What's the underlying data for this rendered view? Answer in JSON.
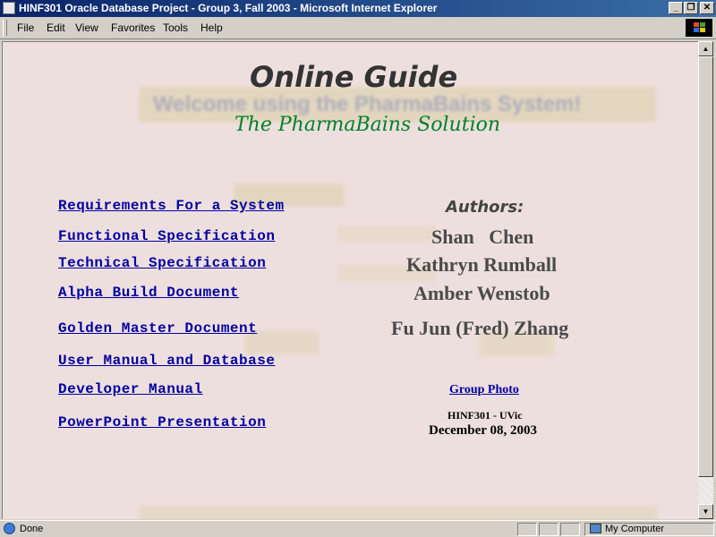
{
  "window": {
    "title": "HINF301 Oracle Database Project - Group 3, Fall 2003 - Microsoft Internet Explorer",
    "controls": [
      "_",
      "❒",
      "✕"
    ]
  },
  "menubar": {
    "items": [
      "File",
      "Edit",
      "View",
      "Favorites",
      "Tools",
      "Help"
    ]
  },
  "page": {
    "heading": "Online Guide",
    "subheading": "The PharmaBains Solution",
    "background_color": "#eedfdf",
    "link_color": "#0000a0",
    "subheading_color": "#00802a",
    "documents": [
      "Requirements For a System",
      "Functional Specification",
      "Technical Specification",
      "Alpha Build Document",
      "Golden Master Document",
      "User Manual and Database",
      "Developer Manual",
      "PowerPoint Presentation"
    ],
    "authors_label": "Authors:",
    "authors": [
      "Shan   Chen",
      "Kathryn Rumball",
      "Amber Wenstob",
      "Fu Jun (Fred) Zhang"
    ],
    "group_photo": "Group Photo",
    "course": "HINF301 - UVic",
    "date": "December 08, 2003",
    "background_watermark": "Welcome using the PharmaBains System!"
  },
  "statusbar": {
    "status": "Done",
    "zone": "My Computer"
  }
}
